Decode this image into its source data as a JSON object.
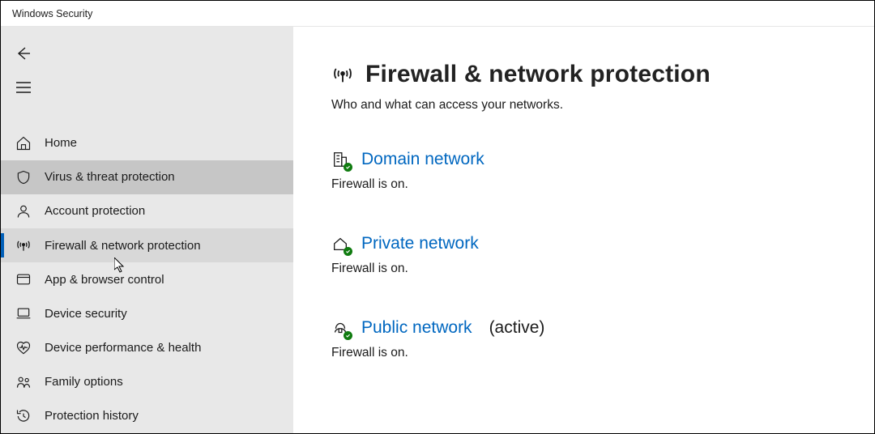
{
  "window": {
    "title": "Windows Security"
  },
  "sidebar": {
    "items": [
      {
        "label": "Home"
      },
      {
        "label": "Virus & threat protection"
      },
      {
        "label": "Account protection"
      },
      {
        "label": "Firewall & network protection"
      },
      {
        "label": "App & browser control"
      },
      {
        "label": "Device security"
      },
      {
        "label": "Device performance & health"
      },
      {
        "label": "Family options"
      },
      {
        "label": "Protection history"
      }
    ]
  },
  "page": {
    "title": "Firewall & network protection",
    "subtitle": "Who and what can access your networks."
  },
  "networks": [
    {
      "title": "Domain network",
      "status": "Firewall is on.",
      "active_label": ""
    },
    {
      "title": "Private network",
      "status": "Firewall is on.",
      "active_label": ""
    },
    {
      "title": "Public network",
      "status": "Firewall is on.",
      "active_label": "(active)"
    }
  ]
}
